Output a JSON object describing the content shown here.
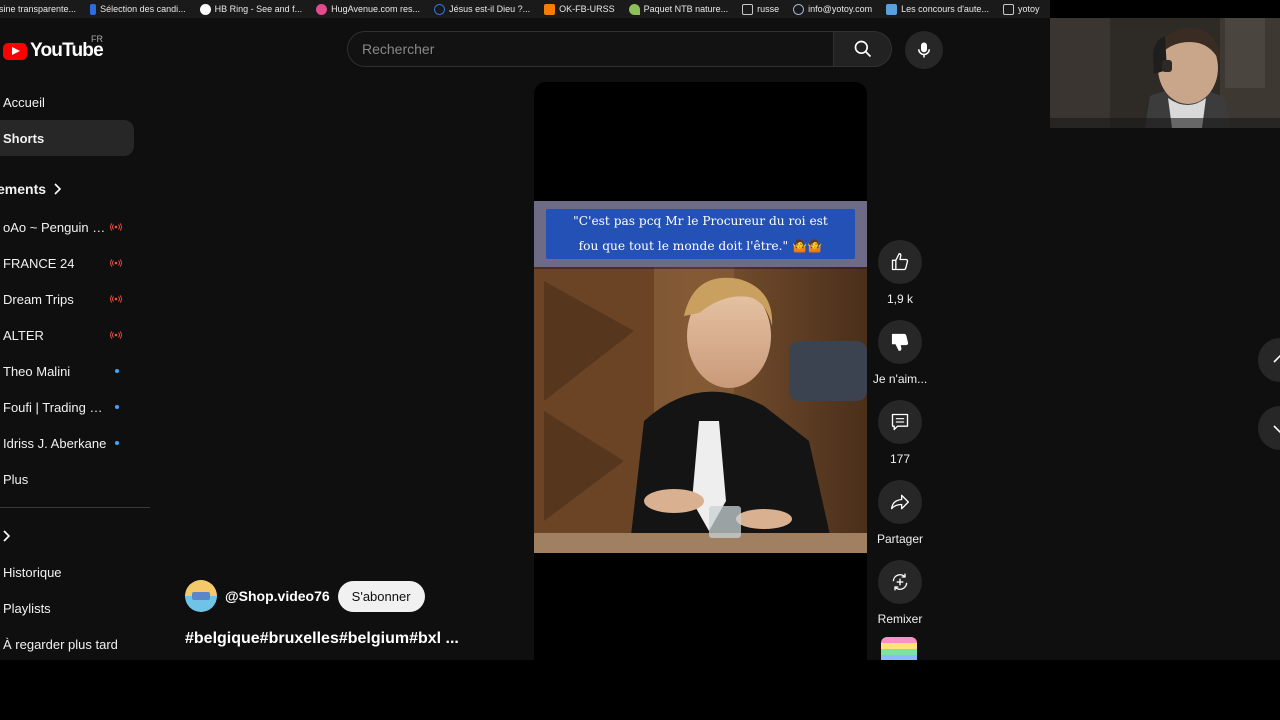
{
  "bookmarks": [
    {
      "label": "ésine transparente...",
      "icon": "blank-page-icon",
      "color": "#1a1a1a"
    },
    {
      "label": "Sélection des candi...",
      "icon": "document-icon",
      "color": "#2d6cdf"
    },
    {
      "label": "HB Ring - See and f...",
      "icon": "github-icon",
      "color": "#ffffff"
    },
    {
      "label": "HugAvenue.com res...",
      "icon": "heart-icon",
      "color": "#e14a8b"
    },
    {
      "label": "Jésus est-il Dieu ?...",
      "icon": "globe-icon",
      "color": "#3b6fd8"
    },
    {
      "label": "OK-FB-URSS",
      "icon": "blogger-icon",
      "color": "#f57d00"
    },
    {
      "label": "Paquet NTB nature...",
      "icon": "plant-icon",
      "color": "#8fbf5a"
    },
    {
      "label": "russe",
      "icon": "folder-icon",
      "color": "#c8c8c8"
    },
    {
      "label": "info@yotoy.com",
      "icon": "globe-icon",
      "color": "#9bb4d6"
    },
    {
      "label": "Les concours d'aute...",
      "icon": "image-icon",
      "color": "#5aa0e0"
    },
    {
      "label": "yotoy",
      "icon": "folder-icon",
      "color": "#c8c8c8"
    },
    {
      "label": "",
      "icon": "amazon-icon",
      "color": "#e8e8e8"
    }
  ],
  "masthead": {
    "logo_text": "YouTube",
    "country": "FR",
    "search_placeholder": "Rechercher"
  },
  "sidebar": {
    "main": [
      {
        "label": "Accueil",
        "active": false
      },
      {
        "label": "Shorts",
        "active": true
      }
    ],
    "subscriptions_heading": "ements",
    "subscriptions": [
      {
        "label": "oAo ~ Penguin J...",
        "status": "live"
      },
      {
        "label": "FRANCE 24",
        "status": "live"
      },
      {
        "label": "Dream Trips",
        "status": "live"
      },
      {
        "label": "ALTER",
        "status": "live"
      },
      {
        "label": "Theo Malini",
        "status": "new"
      },
      {
        "label": "Foufi | Trading & ...",
        "status": "new"
      },
      {
        "label": "Idriss J. Aberkane",
        "status": "new"
      },
      {
        "label": "Plus",
        "status": ""
      }
    ],
    "you_items": [
      {
        "label": "Historique"
      },
      {
        "label": "Playlists"
      },
      {
        "label": "À regarder plus tard"
      }
    ]
  },
  "video": {
    "caption_line1": "\"C'est pas pcq Mr le Procureur du roi est",
    "caption_line2": "fou que tout le monde doit l'être.\" 🤷🤷"
  },
  "actions": {
    "like_count": "1,9 k",
    "dislike_label": "Je n'aim...",
    "comments_count": "177",
    "share_label": "Partager",
    "remix_label": "Remixer"
  },
  "channel": {
    "handle": "@Shop.video76",
    "subscribe_label": "S'abonner"
  },
  "short_title": "#belgique#bruxelles#belgium#bxl ...",
  "colors": {
    "background": "#0f0f0f",
    "youtube_red": "#ff0000",
    "live_red": "#ff4e45",
    "new_dot_blue": "#3ea6ff",
    "caption_blue": "#2451b5"
  }
}
